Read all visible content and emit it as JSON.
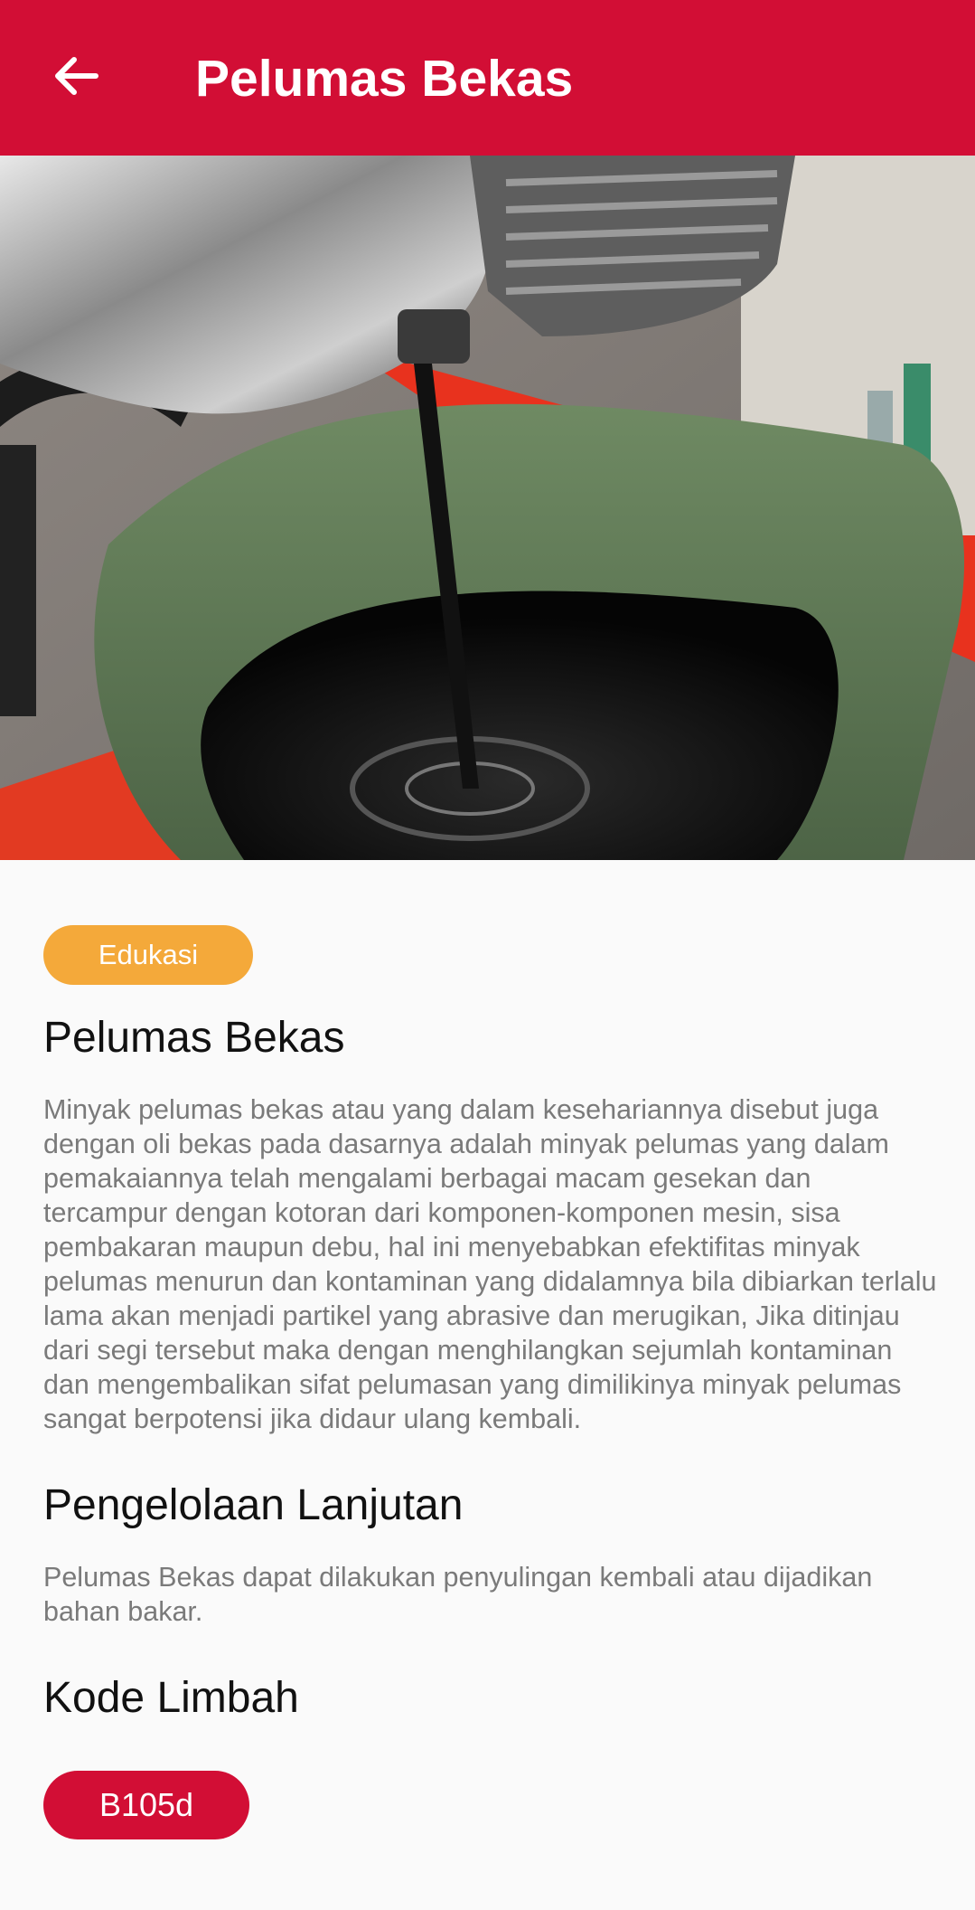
{
  "appbar": {
    "title": "Pelumas Bekas",
    "back_icon": "arrow-left-icon",
    "background": "#d20e35"
  },
  "hero": {
    "subject": "used oil draining from engine into green tub"
  },
  "category_chip": {
    "label": "Edukasi",
    "color": "#f4a93a"
  },
  "article": {
    "title": "Pelumas Bekas",
    "description": "Minyak pelumas bekas atau yang dalam kesehariannya disebut juga dengan oli bekas pada dasarnya adalah minyak pelumas yang dalam pemakaiannya telah mengalami berbagai macam gesekan dan tercampur dengan kotoran dari komponen-komponen mesin, sisa pembakaran maupun debu, hal ini menyebabkan efektifitas minyak pelumas menurun dan kontaminan yang didalamnya bila dibiarkan terlalu lama akan menjadi partikel yang abrasive dan merugikan, Jika ditinjau dari segi tersebut maka dengan menghilangkan sejumlah kontaminan dan mengembalikan sifat pelumasan yang dimilikinya minyak pelumas sangat berpotensi jika didaur ulang kembali.",
    "section_processing_title": "Pengelolaan Lanjutan",
    "section_processing_text": "Pelumas Bekas dapat dilakukan penyulingan kembali atau dijadikan bahan bakar.",
    "section_code_title": "Kode Limbah",
    "waste_code": "B105d",
    "code_color": "#d20e35"
  }
}
